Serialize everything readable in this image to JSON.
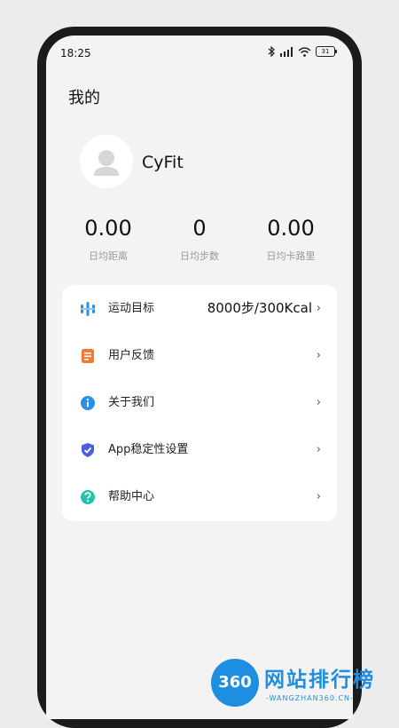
{
  "status_bar": {
    "time": "18:25",
    "battery": "31",
    "icons": [
      "bluetooth-icon",
      "signal-icon",
      "wifi-icon",
      "battery-icon"
    ]
  },
  "page": {
    "title": "我的"
  },
  "profile": {
    "username": "CyFit",
    "avatar_icon": "default-avatar-icon"
  },
  "stats": [
    {
      "value": "0.00",
      "label": "日均距离"
    },
    {
      "value": "0",
      "label": "日均步数"
    },
    {
      "value": "0.00",
      "label": "日均卡路里"
    }
  ],
  "menu": {
    "items": [
      {
        "label": "运动目标",
        "value": "8000步/300Kcal",
        "icon": "goal-bars-icon",
        "color": "#2a8fe8"
      },
      {
        "label": "用户反馈",
        "value": "",
        "icon": "feedback-doc-icon",
        "color": "#f07a30"
      },
      {
        "label": "关于我们",
        "value": "",
        "icon": "info-icon",
        "color": "#2a8fe8"
      },
      {
        "label": "App稳定性设置",
        "value": "",
        "icon": "shield-check-icon",
        "color": "#4a5fe0"
      },
      {
        "label": "帮助中心",
        "value": "",
        "icon": "help-icon",
        "color": "#20c4a8"
      }
    ],
    "chevron": "›"
  },
  "watermark": {
    "logo": "360",
    "text": "网站排行榜",
    "sub": "-WANGZHAN360.CN-"
  },
  "colors": {
    "background": "#f3f3f3",
    "card": "#ffffff",
    "accent": "#1e8fe0"
  }
}
